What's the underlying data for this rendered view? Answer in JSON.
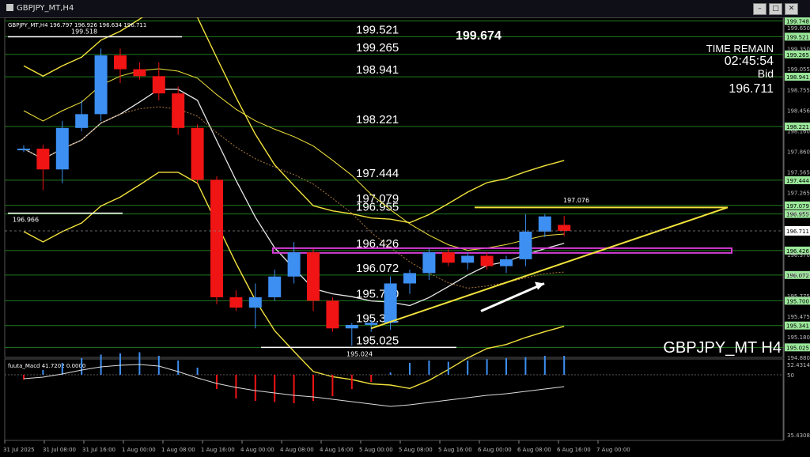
{
  "window": {
    "tab_title": "GBPJPY_MT,H4",
    "controls": [
      "–",
      "□",
      "✕"
    ]
  },
  "chart_data": {
    "type": "candlestick",
    "header": "GBPJPY_MT,H4  196.797 196.926 196.634 196.711",
    "watermark": "GBPJPY_MT H4",
    "time_remain_label": "TIME REMAIN",
    "time_remain_value": "02:45:54",
    "bid_label": "Bid",
    "bid_value": "196.711",
    "ylim": [
      194.88,
      199.8
    ],
    "y_ticks": [
      "199.650",
      "199.350",
      "199.055",
      "198.755",
      "198.456",
      "198.160",
      "197.860",
      "197.565",
      "197.265",
      "196.970",
      "196.370",
      "196.075",
      "195.775",
      "195.475",
      "195.180",
      "194.880"
    ],
    "x_labels": [
      "31 Jul 2025",
      "31 Jul 08:00",
      "31 Jul 16:00",
      "1 Aug 00:00",
      "1 Aug 08:00",
      "1 Aug 16:00",
      "4 Aug 00:00",
      "4 Aug 08:00",
      "4 Aug 16:00",
      "5 Aug 00:00",
      "5 Aug 08:00",
      "5 Aug 16:00",
      "6 Aug 00:00",
      "6 Aug 08:00",
      "6 Aug 16:00",
      "7 Aug 00:00"
    ],
    "candles": [
      {
        "o": 197.9,
        "h": 197.95,
        "l": 197.85,
        "c": 197.9
      },
      {
        "o": 197.9,
        "h": 197.96,
        "l": 197.3,
        "c": 197.6
      },
      {
        "o": 197.6,
        "h": 198.3,
        "l": 197.4,
        "c": 198.2
      },
      {
        "o": 198.2,
        "h": 198.6,
        "l": 198.15,
        "c": 198.4
      },
      {
        "o": 198.4,
        "h": 199.35,
        "l": 198.3,
        "c": 199.25
      },
      {
        "o": 199.25,
        "h": 199.35,
        "l": 198.85,
        "c": 199.05
      },
      {
        "o": 199.05,
        "h": 199.15,
        "l": 198.9,
        "c": 198.95
      },
      {
        "o": 198.95,
        "h": 199.15,
        "l": 198.6,
        "c": 198.7
      },
      {
        "o": 198.7,
        "h": 198.8,
        "l": 198.1,
        "c": 198.2
      },
      {
        "o": 198.2,
        "h": 198.25,
        "l": 197.4,
        "c": 197.45
      },
      {
        "o": 197.45,
        "h": 197.5,
        "l": 195.65,
        "c": 195.75
      },
      {
        "o": 195.75,
        "h": 195.85,
        "l": 195.55,
        "c": 195.6
      },
      {
        "o": 195.6,
        "h": 195.95,
        "l": 195.3,
        "c": 195.75
      },
      {
        "o": 195.75,
        "h": 196.15,
        "l": 195.7,
        "c": 196.05
      },
      {
        "o": 196.05,
        "h": 196.55,
        "l": 195.95,
        "c": 196.4
      },
      {
        "o": 196.4,
        "h": 196.45,
        "l": 195.55,
        "c": 195.7
      },
      {
        "o": 195.7,
        "h": 195.75,
        "l": 195.25,
        "c": 195.3
      },
      {
        "o": 195.3,
        "h": 195.38,
        "l": 195.05,
        "c": 195.35
      },
      {
        "o": 195.35,
        "h": 195.42,
        "l": 195.25,
        "c": 195.38
      },
      {
        "o": 195.38,
        "h": 196.05,
        "l": 195.28,
        "c": 195.95
      },
      {
        "o": 195.95,
        "h": 196.15,
        "l": 195.8,
        "c": 196.1
      },
      {
        "o": 196.1,
        "h": 196.45,
        "l": 196.0,
        "c": 196.4
      },
      {
        "o": 196.4,
        "h": 196.45,
        "l": 196.2,
        "c": 196.25
      },
      {
        "o": 196.25,
        "h": 196.4,
        "l": 196.15,
        "c": 196.35
      },
      {
        "o": 196.35,
        "h": 196.4,
        "l": 196.15,
        "c": 196.2
      },
      {
        "o": 196.2,
        "h": 196.35,
        "l": 196.1,
        "c": 196.3
      },
      {
        "o": 196.3,
        "h": 196.95,
        "l": 196.2,
        "c": 196.7
      },
      {
        "o": 196.7,
        "h": 196.95,
        "l": 196.62,
        "c": 196.92
      },
      {
        "o": 196.797,
        "h": 196.926,
        "l": 196.634,
        "c": 196.711
      }
    ],
    "horizontal_levels": [
      {
        "value": 199.748,
        "label": "",
        "tag": "199.748"
      },
      {
        "value": 199.521,
        "label": "199.521",
        "tag": "199.521"
      },
      {
        "value": 199.265,
        "label": "199.265",
        "tag": "199.265"
      },
      {
        "value": 198.941,
        "label": "198.941",
        "tag": "198.941"
      },
      {
        "value": 198.221,
        "label": "198.221",
        "tag": "198.221"
      },
      {
        "value": 197.444,
        "label": "197.444",
        "tag": "197.444"
      },
      {
        "value": 197.079,
        "label": "197.079",
        "tag": "197.079"
      },
      {
        "value": 196.955,
        "label": "196.955",
        "tag": "196.955"
      },
      {
        "value": 196.426,
        "label": "196.426",
        "tag": "196.426"
      },
      {
        "value": 196.072,
        "label": "196.072",
        "tag": "196.072"
      },
      {
        "value": 195.7,
        "label": "195.700",
        "tag": "195.700"
      },
      {
        "value": 195.341,
        "label": "195.341",
        "tag": "195.341"
      },
      {
        "value": 195.025,
        "label": "195.025",
        "tag": "195.025"
      }
    ],
    "top_label": "199.674",
    "marker_labels": {
      "high": "199.518",
      "left_level": "196.966",
      "low": "195.024",
      "right_level": "197.076"
    },
    "current_price": 196.711,
    "indicator": {
      "label": "fuuta_Macd 41.7202  0.0000",
      "y_top": "52.4314",
      "y_mid": "50",
      "y_bottom": "35.4308",
      "bars": [
        -0.2,
        0.2,
        0.5,
        0.7,
        0.85,
        0.9,
        0.95,
        0.8,
        0.6,
        0.3,
        -0.6,
        -1.0,
        -1.1,
        -1.15,
        -1.2,
        -1.1,
        -0.9,
        -0.6,
        -0.3,
        0.1,
        0.5,
        0.6,
        0.55,
        0.6,
        0.65,
        0.7,
        0.75,
        0.8,
        0.8
      ],
      "signal": [
        -0.25,
        -0.15,
        0.05,
        0.3,
        0.5,
        0.6,
        0.65,
        0.55,
        0.2,
        -0.2,
        -0.55,
        -0.8,
        -1.0,
        -1.15,
        -1.3,
        -1.4,
        -1.55,
        -1.7,
        -1.85,
        -2.0,
        -1.9,
        -1.75,
        -1.6,
        -1.45,
        -1.3,
        -1.2,
        -1.05,
        -0.9,
        -0.75
      ]
    },
    "colors": {
      "bull": "#3d8ff2",
      "bear": "#f01414",
      "level": "#1f7a1f",
      "tag": "#9be89b",
      "band": "#f2e23c",
      "ma": "#e8e8e8",
      "zone": "#d63cd6",
      "trendline": "#f2e23c"
    }
  }
}
